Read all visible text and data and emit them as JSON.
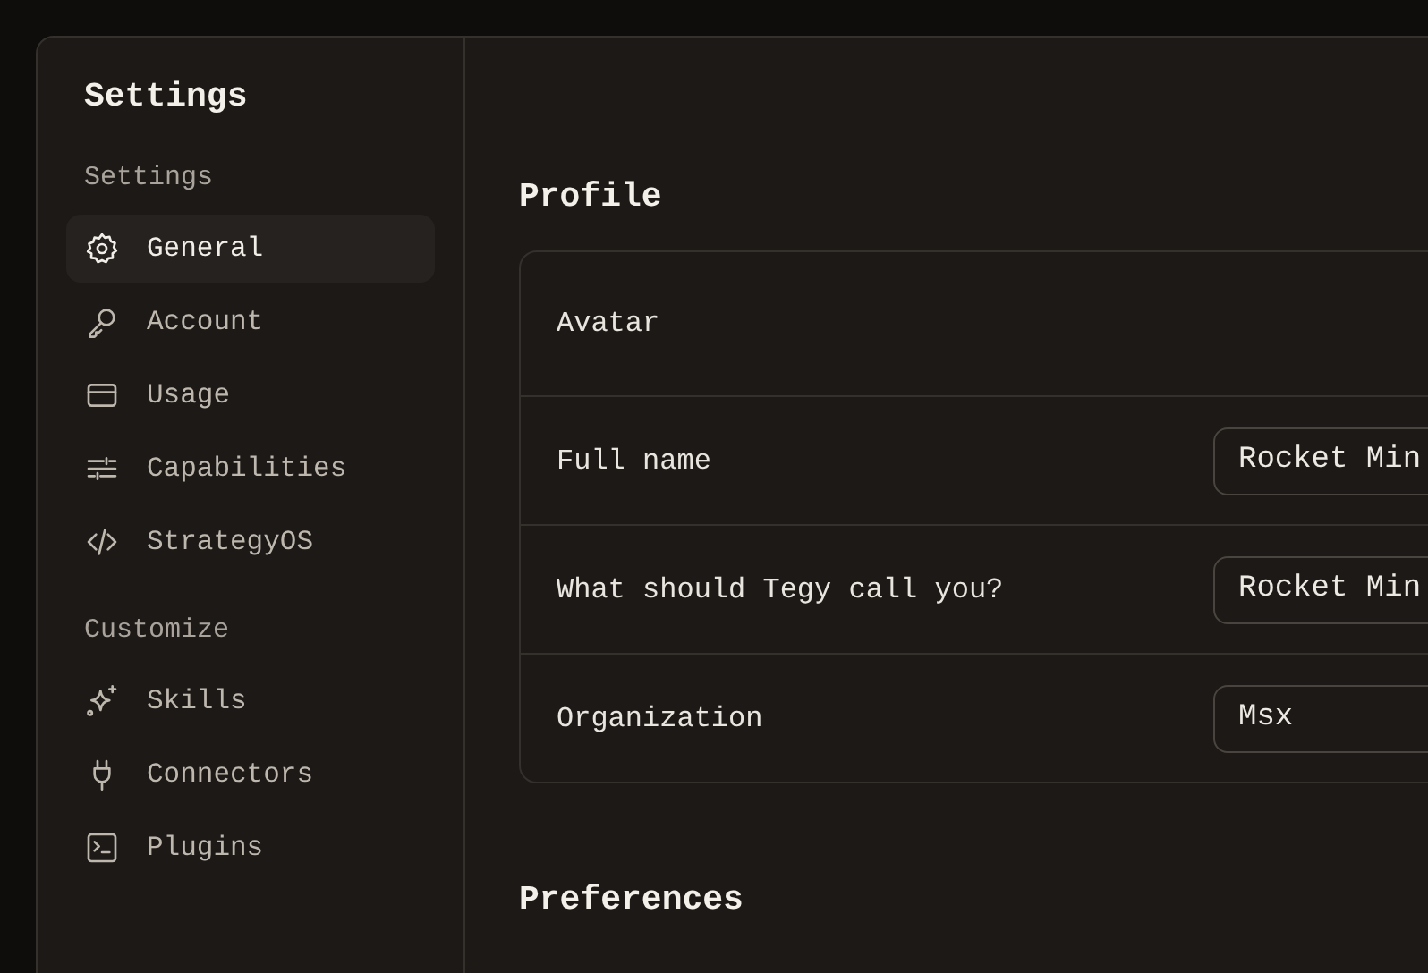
{
  "sidebar": {
    "title": "Settings",
    "sections": [
      {
        "heading": "Settings",
        "items": [
          {
            "label": "General",
            "selected": true
          },
          {
            "label": "Account",
            "selected": false
          },
          {
            "label": "Usage",
            "selected": false
          },
          {
            "label": "Capabilities",
            "selected": false
          },
          {
            "label": "StrategyOS",
            "selected": false
          }
        ]
      },
      {
        "heading": "Customize",
        "items": [
          {
            "label": "Skills",
            "selected": false
          },
          {
            "label": "Connectors",
            "selected": false
          },
          {
            "label": "Plugins",
            "selected": false
          }
        ]
      }
    ]
  },
  "main": {
    "sections": [
      {
        "title": "Profile",
        "rows": [
          {
            "label": "Avatar",
            "kind": "avatar"
          },
          {
            "label": "Full name",
            "kind": "field",
            "value": "Rocket Min"
          },
          {
            "label": "What should Tegy call you?",
            "kind": "field",
            "value": "Rocket Min"
          },
          {
            "label": "Organization",
            "kind": "field",
            "value": "Msx"
          }
        ]
      },
      {
        "title": "Preferences"
      }
    ]
  }
}
